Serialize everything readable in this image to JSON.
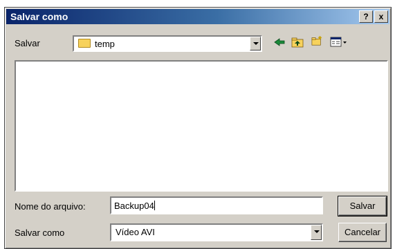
{
  "window": {
    "title": "Salvar como",
    "help_label": "?",
    "close_label": "x"
  },
  "location": {
    "label": "Salvar",
    "folder": "temp"
  },
  "toolbar": {
    "icons": [
      "back-icon",
      "up-folder-icon",
      "new-folder-icon",
      "view-menu-icon"
    ]
  },
  "file_list": {
    "items": []
  },
  "filename": {
    "label": "Nome do arquivo:",
    "value": "Backup04"
  },
  "filetype": {
    "label": "Salvar como",
    "value": "Vídeo AVI"
  },
  "buttons": {
    "save": "Salvar",
    "cancel": "Cancelar"
  }
}
